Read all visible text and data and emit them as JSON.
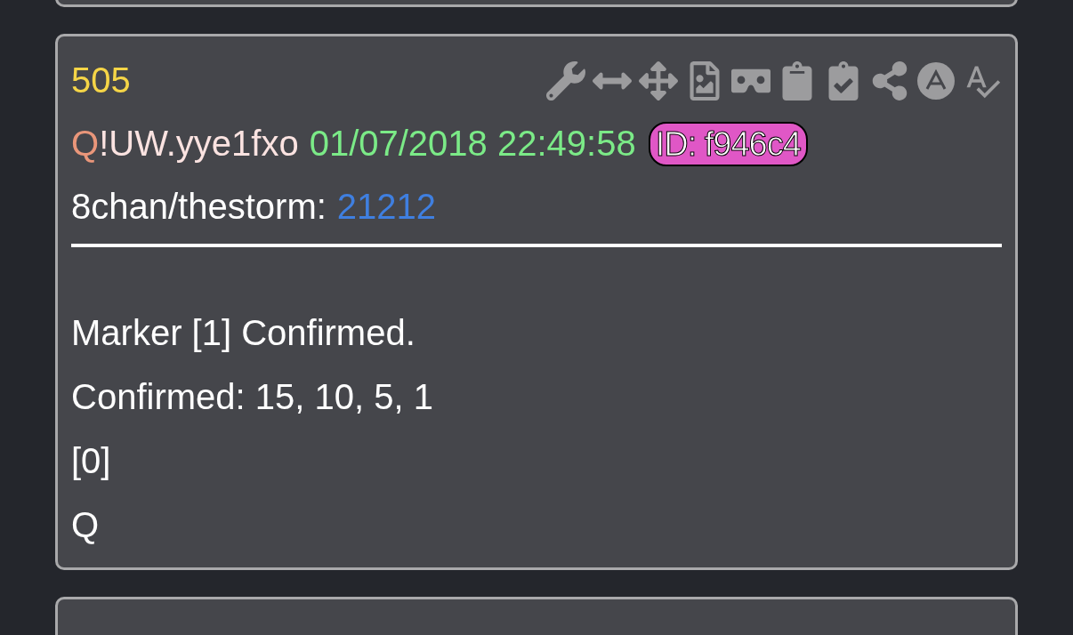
{
  "post": {
    "number": "505",
    "author": {
      "name": "Q",
      "tripcode": "!UW.yye1fxo"
    },
    "timestamp": "01/07/2018 22:49:58",
    "id_badge": "ID: f946c4",
    "source": {
      "label": "8chan/thestorm:",
      "link": "21212"
    },
    "body": [
      "Marker [1] Confirmed.",
      "Confirmed: 15, 10, 5, 1",
      "[0]",
      "Q"
    ]
  }
}
